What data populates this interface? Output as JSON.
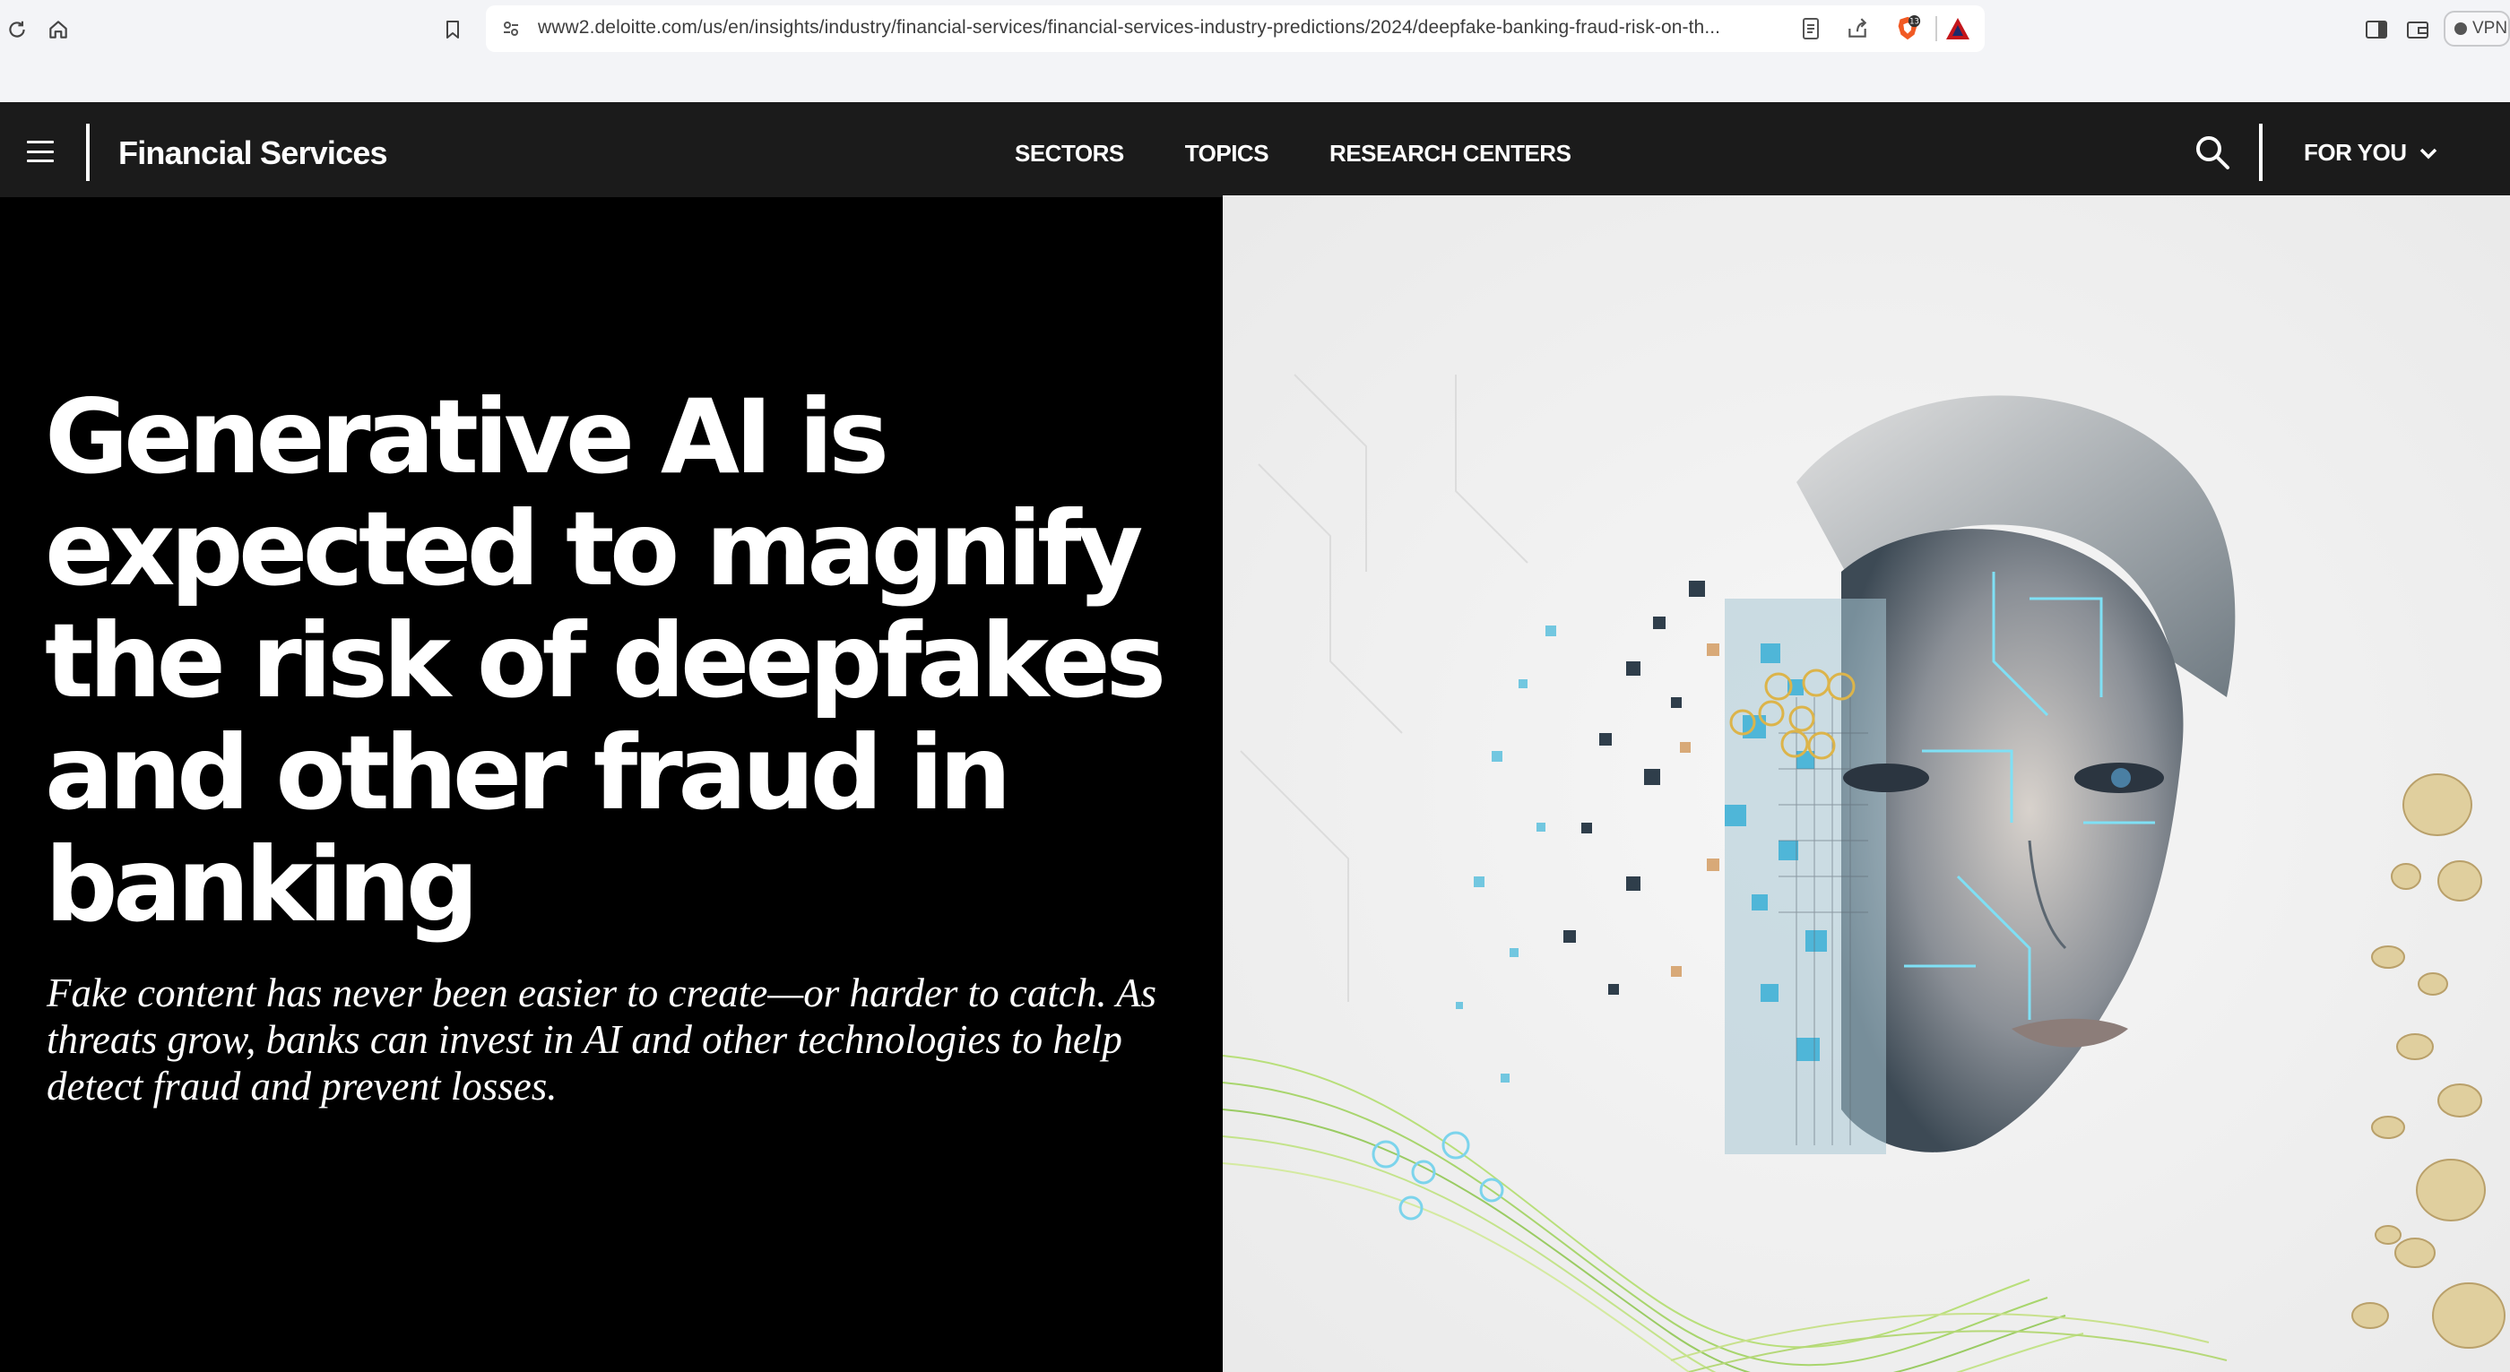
{
  "browser": {
    "url": "www2.deloitte.com/us/en/insights/industry/financial-services/financial-services-industry-predictions/2024/deepfake-banking-fraud-risk-on-th...",
    "shield_count": "13",
    "vpn_label": "VPN",
    "icons": [
      "reload-icon",
      "home-icon",
      "bookmark-icon",
      "site-settings-icon",
      "reader-mode-icon",
      "share-icon",
      "brave-shield-icon",
      "brave-rewards-icon",
      "sidebar-icon",
      "wallet-icon"
    ]
  },
  "nav": {
    "brand": "Financial Services",
    "links": [
      "SECTORS",
      "TOPICS",
      "RESEARCH CENTERS"
    ],
    "foryou": "FOR YOU"
  },
  "hero": {
    "title": "Generative AI is expected to magnify the risk of deepfakes and other fraud in banking",
    "subtitle": "Fake content has never been easier to create—or harder to catch. As threats grow, banks can invest in AI and other technologies to help detect fraud and prevent losses.",
    "image_description_colors": {
      "background": "#f2f2f2",
      "cyan": "#5fc8e6",
      "gold": "#d9b55a",
      "green": "#9cd36b"
    }
  }
}
